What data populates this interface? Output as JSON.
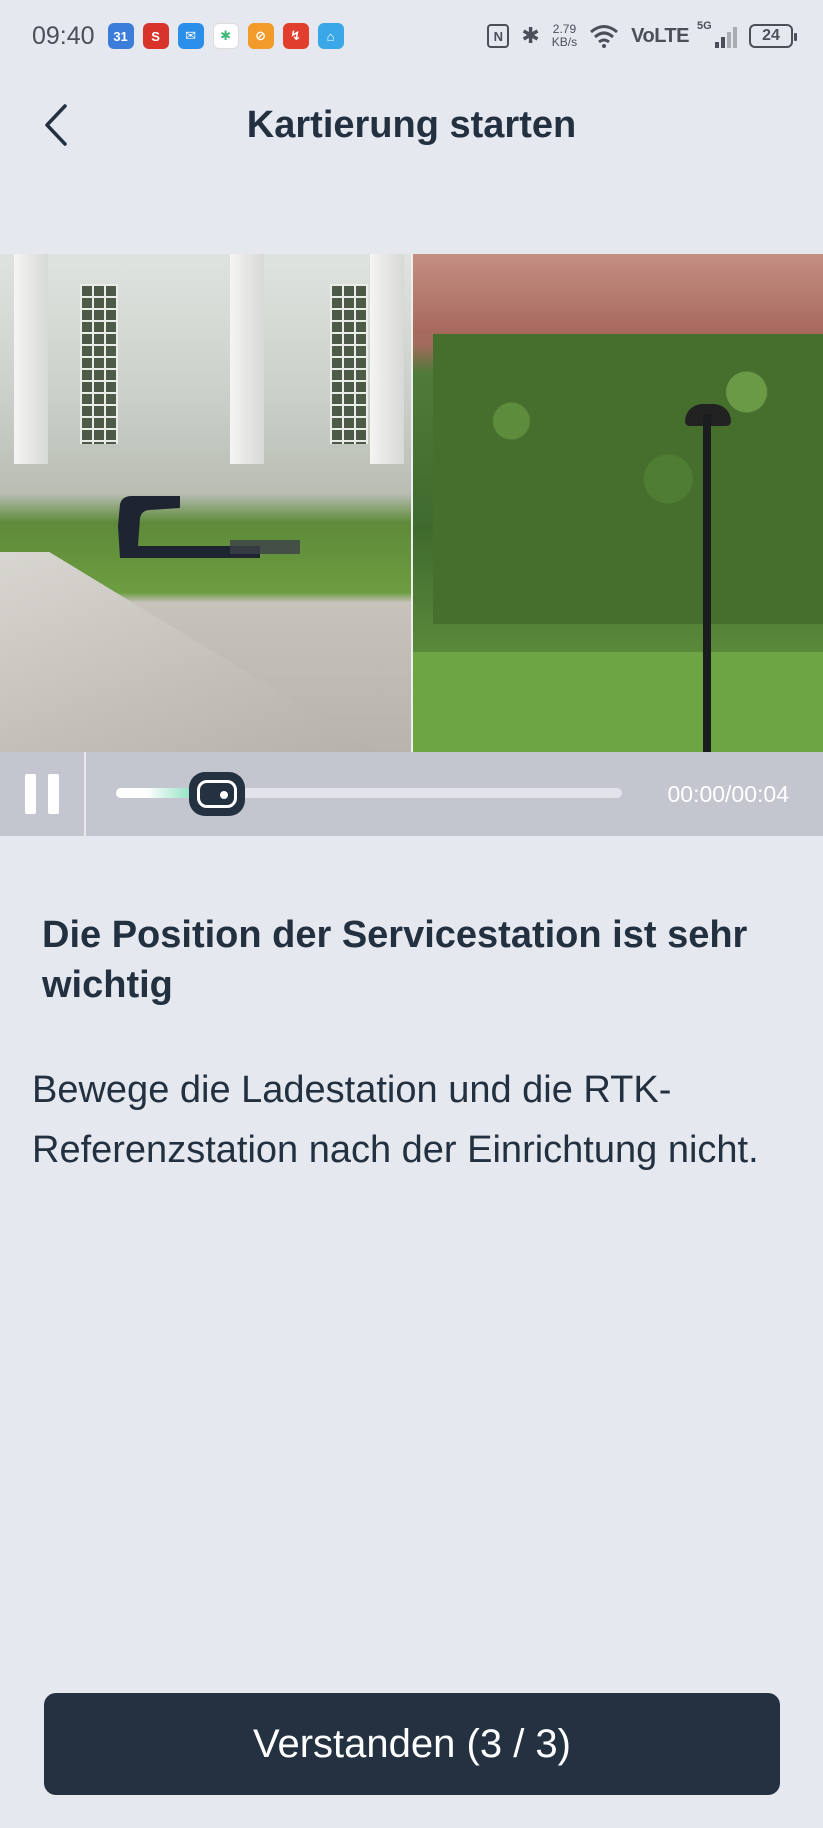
{
  "status_bar": {
    "time": "09:40",
    "apps": [
      {
        "icon": "calendar-icon",
        "text": "31",
        "color": "#3b7dd8"
      },
      {
        "icon": "s-app-icon",
        "text": "S",
        "color": "#d8342c"
      },
      {
        "icon": "mail-icon",
        "text": "✉",
        "color": "#2b8ee8"
      },
      {
        "icon": "slack-icon",
        "text": "✱",
        "color": "#ffffff"
      },
      {
        "icon": "pen-app-icon",
        "text": "⊘",
        "color": "#f29a2a"
      },
      {
        "icon": "red-app-icon",
        "text": "↯",
        "color": "#e23e2e"
      },
      {
        "icon": "home-app-icon",
        "text": "⌂",
        "color": "#3aa8e8"
      }
    ],
    "net_speed_value": "2.79",
    "net_speed_unit": "KB/s",
    "volte": "VoLTE",
    "network": "5G",
    "battery": "24"
  },
  "header": {
    "title": "Kartierung starten"
  },
  "video": {
    "time": "00:00/00:04",
    "progress": 0.2
  },
  "content": {
    "heading": "Die Position der Servicestation ist sehr wichtig",
    "body": "Bewege die Ladestation und die RTK-Referenzstation nach der Einrichtung nicht."
  },
  "cta": {
    "label": "Verstanden (3 / 3)"
  },
  "colors": {
    "background": "#e6e8f0",
    "primary_dark": "#243140",
    "progress_accent": "#57d1a3"
  }
}
